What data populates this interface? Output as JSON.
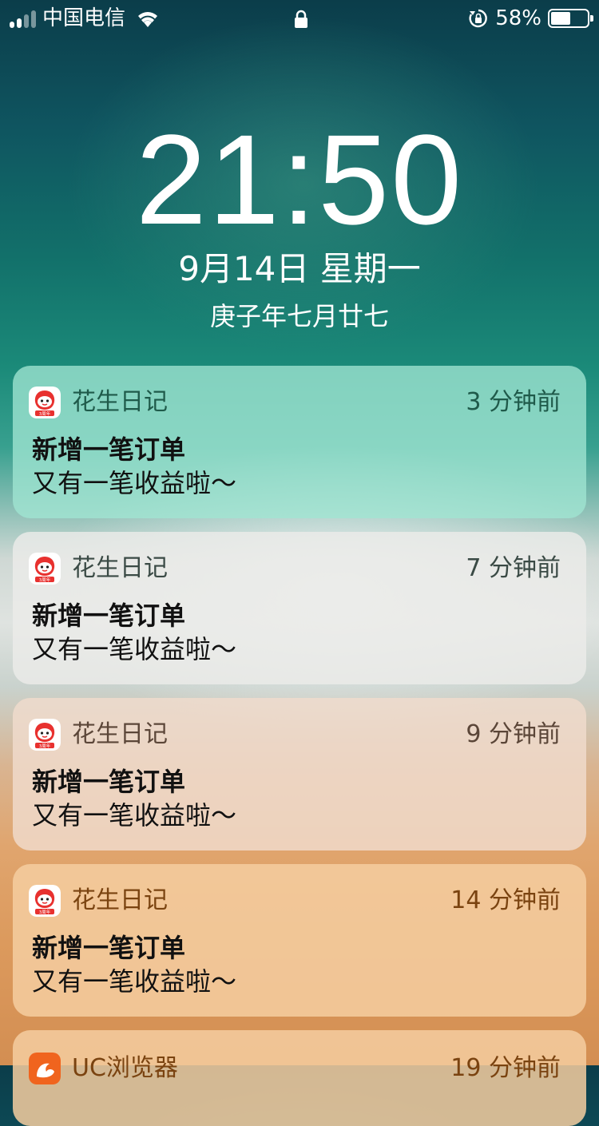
{
  "status_bar": {
    "carrier": "中国电信",
    "battery_percent": "58%",
    "battery_level": 0.58
  },
  "lock_screen": {
    "time": "21:50",
    "date": "9月14日 星期一",
    "lunar_date": "庚子年七月廿七"
  },
  "notifications": [
    {
      "app": "花生日记",
      "time": "3 分钟前",
      "title": "新增一笔订单",
      "body": "又有一笔收益啦～",
      "icon": "peanut-diary-icon"
    },
    {
      "app": "花生日记",
      "time": "7 分钟前",
      "title": "新增一笔订单",
      "body": "又有一笔收益啦～",
      "icon": "peanut-diary-icon"
    },
    {
      "app": "花生日记",
      "time": "9 分钟前",
      "title": "新增一笔订单",
      "body": "又有一笔收益啦～",
      "icon": "peanut-diary-icon"
    },
    {
      "app": "花生日记",
      "time": "14 分钟前",
      "title": "新增一笔订单",
      "body": "又有一笔收益啦～",
      "icon": "peanut-diary-icon"
    },
    {
      "app": "UC浏览器",
      "time": "19 分钟前",
      "icon": "uc-browser-icon"
    }
  ],
  "icon_badge_text": "3周年",
  "colors": {
    "peanut_icon_red": "#e8312f",
    "uc_icon_orange": "#f0641e"
  }
}
